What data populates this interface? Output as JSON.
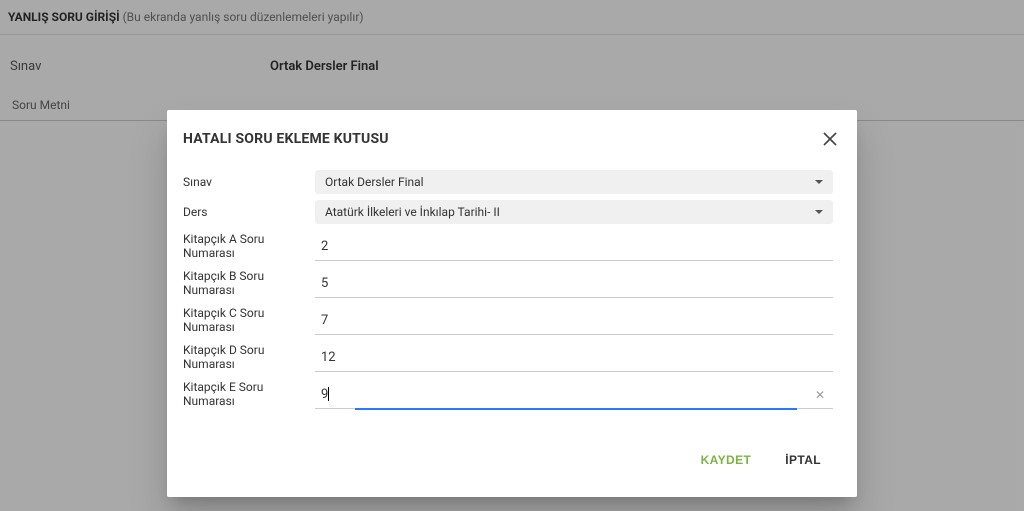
{
  "page": {
    "title_bold": "YANLIŞ SORU GİRİŞİ",
    "title_sub": "(Bu ekranda yanlış soru düzenlemeleri yapılır)"
  },
  "background": {
    "filter_label": "Sınav",
    "filter_value": "Ortak Dersler Final",
    "col_soru_metni": "Soru Metni"
  },
  "dialog": {
    "title": "HATALI SORU EKLEME KUTUSU",
    "fields": {
      "sinav": {
        "label": "Sınav",
        "value": "Ortak Dersler Final"
      },
      "ders": {
        "label": "Ders",
        "value": "Atatürk İlkeleri ve İnkılap Tarihi- II"
      },
      "kitA": {
        "label": "Kitapçık A Soru Numarası",
        "value": "2"
      },
      "kitB": {
        "label": "Kitapçık B Soru Numarası",
        "value": "5"
      },
      "kitC": {
        "label": "Kitapçık C Soru Numarası",
        "value": "7"
      },
      "kitD": {
        "label": "Kitapçık D Soru Numarası",
        "value": "12"
      },
      "kitE": {
        "label": "Kitapçık E Soru Numarası",
        "value": "9"
      }
    },
    "actions": {
      "save": "KAYDET",
      "cancel": "İPTAL"
    }
  }
}
